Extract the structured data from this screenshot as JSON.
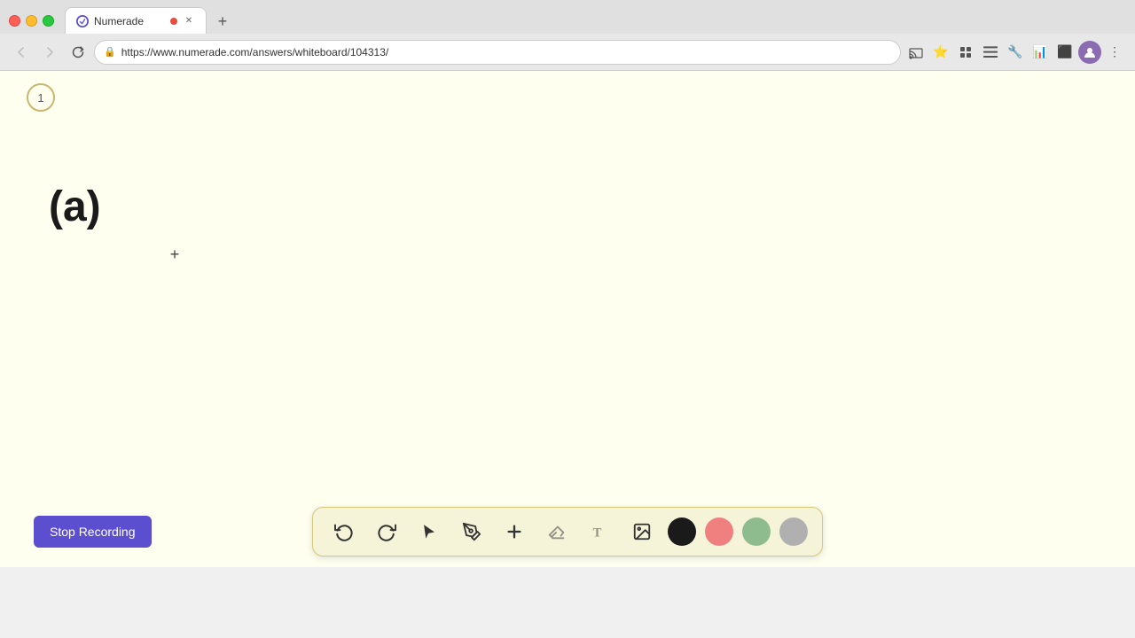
{
  "browser": {
    "title": "Numerade",
    "url": "https://www.numerade.com/answers/whiteboard/104313/",
    "tab_label": "Numerade",
    "new_tab_label": "+",
    "back_title": "Back",
    "forward_title": "Forward",
    "reload_title": "Reload"
  },
  "whiteboard": {
    "page_number": "1",
    "math_text": "(a)",
    "cursor_symbol": "+"
  },
  "toolbar": {
    "undo_label": "Undo",
    "redo_label": "Redo",
    "select_label": "Select",
    "pen_label": "Pen",
    "add_label": "Add",
    "eraser_label": "Eraser",
    "text_label": "Text",
    "image_label": "Insert Image",
    "colors": [
      {
        "name": "black",
        "hex": "#1a1a1a"
      },
      {
        "name": "pink",
        "hex": "#f08080"
      },
      {
        "name": "green",
        "hex": "#8fbc8f"
      },
      {
        "name": "gray",
        "hex": "#b0b0b0"
      }
    ]
  },
  "controls": {
    "stop_recording_label": "Stop Recording"
  }
}
